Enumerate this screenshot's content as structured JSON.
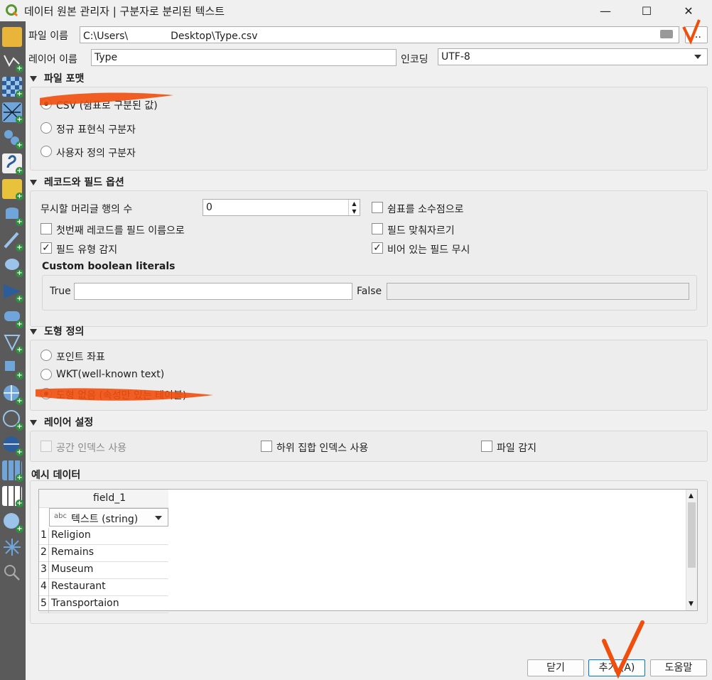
{
  "window": {
    "title": "데이터 원본 관리자 | 구분자로 분리된 텍스트",
    "min_label": "—",
    "max_label": "☐",
    "close_label": "✕"
  },
  "file": {
    "label": "파일 이름",
    "value_prefix": "C:\\Users\\",
    "value_suffix": "Desktop\\Type.csv",
    "browse_label": "…"
  },
  "layer": {
    "label": "레이어 이름",
    "value": "Type",
    "encoding_label": "인코딩",
    "encoding_value": "UTF-8"
  },
  "file_format": {
    "header": "파일 포맷",
    "options": [
      "CSV (쉼표로 구분된 값)",
      "정규 표현식 구분자",
      "사용자 정의 구분자"
    ],
    "selected": 0
  },
  "record_options": {
    "header": "레코드와 필드 옵션",
    "skip_label": "무시할 머리글 행의 수",
    "skip_value": "0",
    "decimal_comma": {
      "label": "쉼표를 소수점으로",
      "checked": false
    },
    "first_record_names": {
      "label": "첫번째 레코드를 필드 이름으로",
      "checked": false
    },
    "trim_fields": {
      "label": "필드 맞춰자르기",
      "checked": false
    },
    "detect_types": {
      "label": "필드 유형 감지",
      "checked": true
    },
    "discard_empty": {
      "label": "비어 있는 필드 무시",
      "checked": true
    },
    "boolean_title": "Custom boolean literals",
    "true_label": "True",
    "false_label": "False"
  },
  "geometry": {
    "header": "도형 정의",
    "options": [
      "포인트 좌표",
      "WKT(well-known text)",
      "도형 없음 (속성만 있는 테이블)"
    ],
    "selected": 2
  },
  "layer_settings": {
    "header": "레이어 설정",
    "spatial_index": {
      "label": "공간 인덱스 사용",
      "checked": false,
      "disabled": true
    },
    "subset_index": {
      "label": "하위 집합 인덱스 사용",
      "checked": false
    },
    "watch_file": {
      "label": "파일 감지",
      "checked": false
    }
  },
  "sample": {
    "header": "예시 데이터",
    "column_header": "field_1",
    "type_prefix": "abc",
    "type_label": "텍스트 (string)",
    "rows": [
      {
        "num": "1",
        "value": "Religion"
      },
      {
        "num": "2",
        "value": "Remains"
      },
      {
        "num": "3",
        "value": "Museum"
      },
      {
        "num": "4",
        "value": "Restaurant"
      },
      {
        "num": "5",
        "value": "Transportaion"
      }
    ]
  },
  "buttons": {
    "close": "닫기",
    "add": "추가 (A)",
    "help": "도움말"
  },
  "colors": {
    "annotation": "#f04e0c",
    "sidebar": "#5a5a5a",
    "qgis_green": "#589632"
  },
  "sidebar_icons": [
    "open-data-source-manager-icon",
    "add-vector-layer-icon",
    "add-raster-layer-icon",
    "add-mesh-layer-icon",
    "add-delimited-text-layer-icon",
    "add-geopackage-layer-icon",
    "add-spatialite-layer-icon",
    "add-postgis-layer-icon",
    "add-mssql-layer-icon",
    "add-oracle-layer-icon",
    "add-virtual-layer-icon",
    "add-sap-hana-layer-icon",
    "add-wms-layer-icon",
    "add-wcs-layer-icon",
    "add-wfs-layer-icon",
    "add-arcgis-layer-icon",
    "add-xyz-layer-icon",
    "add-vector-tile-layer-icon",
    "add-point-cloud-layer-icon",
    "add-metasearch-icon",
    "add-gps-layer-icon"
  ]
}
